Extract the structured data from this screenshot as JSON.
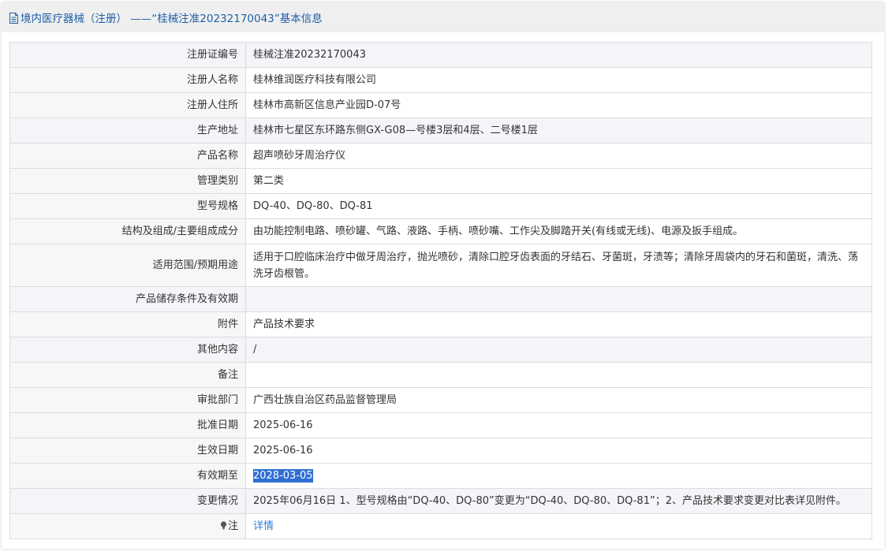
{
  "header": {
    "title": "境内医疗器械（注册） ——“桂械注准20232170043”基本信息"
  },
  "rows": [
    {
      "key": "注册证编号",
      "value": "桂械注准20232170043"
    },
    {
      "key": "注册人名称",
      "value": "桂林维润医疗科技有限公司"
    },
    {
      "key": "注册人住所",
      "value": "桂林市高新区信息产业园D-07号"
    },
    {
      "key": "生产地址",
      "value": "桂林市七星区东环路东侧GX-G08—号楼3层和4层、二号楼1层"
    },
    {
      "key": "产品名称",
      "value": "超声喷砂牙周治疗仪"
    },
    {
      "key": "管理类别",
      "value": "第二类"
    },
    {
      "key": "型号规格",
      "value": "DQ-40、DQ-80、DQ-81"
    },
    {
      "key": "结构及组成/主要组成成分",
      "value": "由功能控制电路、喷砂罐、气路、液路、手柄、喷砂嘴、工作尖及脚踏开关(有线或无线)、电源及扳手组成。"
    },
    {
      "key": "适用范围/预期用途",
      "value": "适用于口腔临床治疗中做牙周治疗，抛光喷砂，清除口腔牙齿表面的牙结石、牙菌斑，牙渍等；清除牙周袋内的牙石和菌斑，清洗、荡洗牙齿根管。"
    },
    {
      "key": "产品储存条件及有效期",
      "value": ""
    },
    {
      "key": "附件",
      "value": "产品技术要求"
    },
    {
      "key": "其他内容",
      "value": "/"
    },
    {
      "key": "备注",
      "value": ""
    },
    {
      "key": "审批部门",
      "value": "广西壮族自治区药品监督管理局"
    },
    {
      "key": "批准日期",
      "value": "2025-06-16"
    },
    {
      "key": "生效日期",
      "value": "2025-06-16"
    },
    {
      "key": "有效期至",
      "value": "2028-03-05"
    },
    {
      "key": "变更情况",
      "value": "2025年06月16日 1、型号规格由“DQ-40、DQ-80”变更为“DQ-40、DQ-80、DQ-81”；2、产品技术要求变更对比表详见附件。"
    },
    {
      "key": "注",
      "value": "详情"
    }
  ],
  "colors": {
    "header_text": "#1f5fa8",
    "link": "#2f7fd6",
    "selection": "#2f6fd3"
  },
  "icons": {
    "header": "document-icon",
    "note": "lightbulb-icon"
  }
}
